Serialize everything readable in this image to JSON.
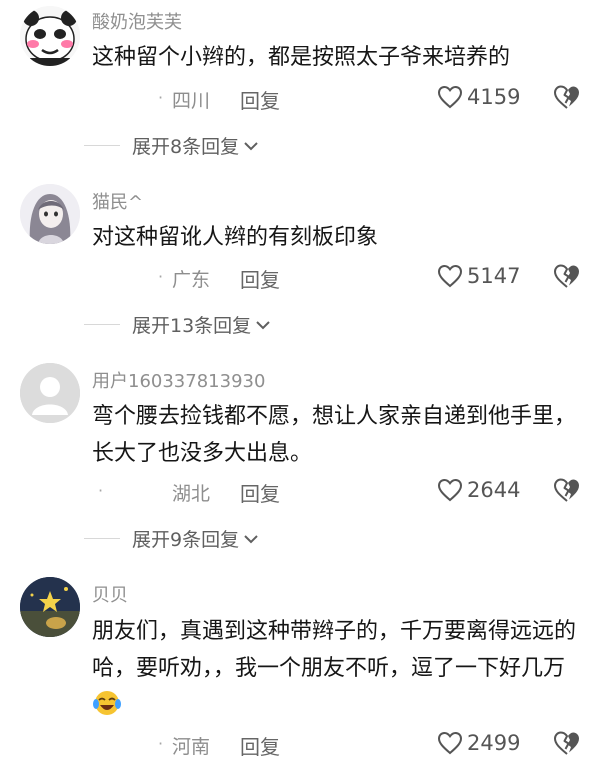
{
  "comments": [
    {
      "username": "酸奶泡芙芙",
      "text": "这种留个小辫的，都是按照太子爷来培养的",
      "location": "四川",
      "reply_label": "回复",
      "likes": "4159",
      "expand_label": "展开8条回复",
      "avatar_icon": "panda-meme-avatar"
    },
    {
      "username": "猫民^",
      "text": "对这种留讹人辫的有刻板印象",
      "location": "广东",
      "reply_label": "回复",
      "likes": "5147",
      "expand_label": "展开13条回复",
      "avatar_icon": "anime-girl-avatar"
    },
    {
      "username": "用户160337813930",
      "text": "弯个腰去捡钱都不愿，想让人家亲自递到他手里，长大了也没多大出息。",
      "location": "湖北",
      "reply_label": "回复",
      "likes": "2644",
      "expand_label": "展开9条回复",
      "avatar_icon": "default-user-avatar"
    },
    {
      "username": "贝贝",
      "text": "朋友们，真遇到这种带辫子的，千万要离得远远的哈，要听劝，，我一个朋友不听，逗了一下好几万",
      "location": "河南",
      "reply_label": "回复",
      "likes": "2499",
      "avatar_icon": "night-scene-avatar"
    }
  ],
  "icons": {
    "like": "heart-outline-icon",
    "dislike": "broken-heart-icon",
    "expand": "chevron-down-icon",
    "emoji": "crying-laughing-emoji-icon"
  },
  "colors": {
    "username": "#8f8f8f",
    "text": "#161616",
    "meta": "#8e8e8e",
    "icon": "#555555"
  }
}
